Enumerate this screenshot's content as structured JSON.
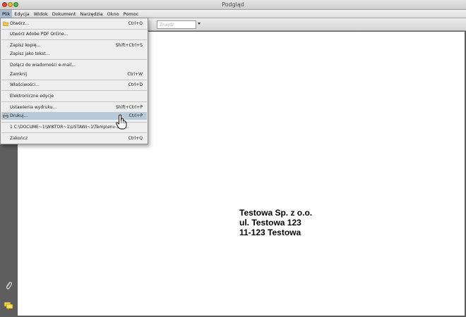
{
  "window": {
    "title": "Podgląd"
  },
  "menubar": [
    "Plik",
    "Edycja",
    "Widok",
    "Dokument",
    "Narzędzia",
    "Okno",
    "Pomoc"
  ],
  "toolbar": {
    "search_placeholder": "Znajdź"
  },
  "file_menu": [
    {
      "label": "Otwórz...",
      "shortcut": "Ctrl+O"
    },
    {
      "label": "Utwórz Adobe PDF Online...",
      "shortcut": ""
    },
    {
      "label": "Zapisz kopię...",
      "shortcut": "Shift+Ctrl+S"
    },
    {
      "label": "Zapisz jako tekst...",
      "shortcut": ""
    },
    {
      "label": "Dołącz do wiadomości e-mail...",
      "shortcut": ""
    },
    {
      "label": "Zamknij",
      "shortcut": "Ctrl+W"
    },
    {
      "label": "Właściwości...",
      "shortcut": "Ctrl+D"
    },
    {
      "label": "Elektroniczne edycje",
      "shortcut": ""
    },
    {
      "label": "Ustawienia wydruku...",
      "shortcut": "Shift+Ctrl+P"
    },
    {
      "label": "Drukuj...",
      "shortcut": "Ctrl+P"
    },
    {
      "label": "1 C:\\DOCUME~1\\WIKTOR~1\\USTAWI~1\\Temp\\env-323...",
      "shortcut": ""
    },
    {
      "label": "Zakończ",
      "shortcut": "Ctrl+Q"
    }
  ],
  "document": {
    "address": [
      "Testowa Sp. z o.o.",
      "ul. Testowa 123",
      "11-123 Testowa"
    ]
  },
  "colors": {
    "highlight": "#b8cad8",
    "active_menu": "#a9bdd0"
  }
}
